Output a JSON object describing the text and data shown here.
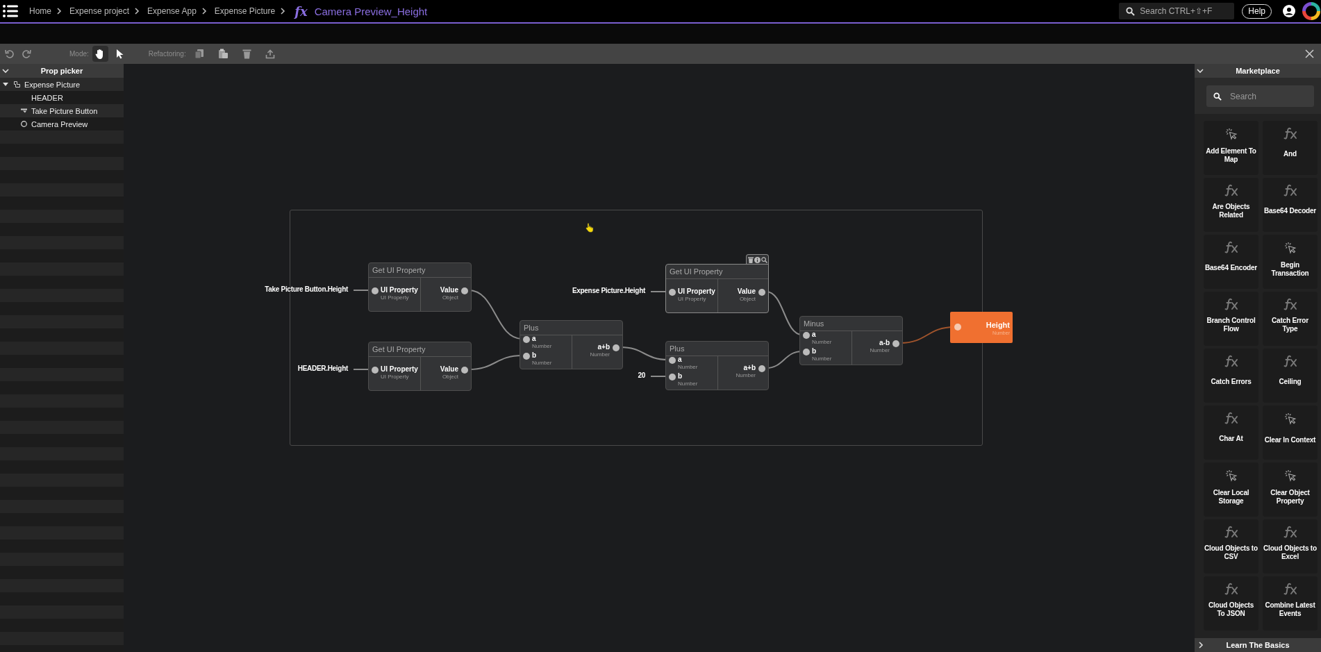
{
  "breadcrumb": [
    "Home",
    "Expense project",
    "Expense App",
    "Expense Picture"
  ],
  "page": {
    "glyph": "fx",
    "title": "Camera Preview_Height"
  },
  "search": {
    "placeholder": "Search CTRL+⇧+F"
  },
  "help_button": "Help",
  "toolbar": {
    "mode_label": "Mode:",
    "modes": [
      {
        "kind": "hand",
        "selected": true
      },
      {
        "kind": "pointer",
        "selected": false
      }
    ],
    "refactoring_label": "Refactoring:"
  },
  "prop_picker": {
    "title": "Prop picker",
    "tree": [
      {
        "label": "Expense Picture",
        "kind": "page",
        "expanded": true,
        "children": [
          {
            "label": "HEADER",
            "kind": "text"
          },
          {
            "label": "Take Picture Button",
            "kind": "button"
          },
          {
            "label": "Camera Preview",
            "kind": "camera"
          }
        ]
      }
    ]
  },
  "graph": {
    "sources": [
      "Take Picture Button.Height",
      "HEADER.Height",
      "Expense Picture.Height",
      "20"
    ],
    "nodes": [
      {
        "title": "Get UI Property",
        "hovered": false,
        "inputs": [
          {
            "name": "UI Property",
            "type": "UI Property"
          }
        ],
        "outputs": [
          {
            "name": "Value",
            "type": "Object"
          }
        ]
      },
      {
        "title": "Get UI Property",
        "hovered": false,
        "inputs": [
          {
            "name": "UI Property",
            "type": "UI Property"
          }
        ],
        "outputs": [
          {
            "name": "Value",
            "type": "Object"
          }
        ]
      },
      {
        "title": "Plus",
        "hovered": false,
        "inputs": [
          {
            "name": "a",
            "type": "Number"
          },
          {
            "name": "b",
            "type": "Number"
          }
        ],
        "outputs": [
          {
            "name": "a+b",
            "type": "Number"
          }
        ]
      },
      {
        "title": "Get UI Property",
        "hovered": true,
        "inputs": [
          {
            "name": "UI Property",
            "type": "UI Property"
          }
        ],
        "outputs": [
          {
            "name": "Value",
            "type": "Object"
          }
        ]
      },
      {
        "title": "Plus",
        "hovered": false,
        "inputs": [
          {
            "name": "a",
            "type": "Number"
          },
          {
            "name": "b",
            "type": "Number"
          }
        ],
        "outputs": [
          {
            "name": "a+b",
            "type": "Number"
          }
        ]
      },
      {
        "title": "Minus",
        "hovered": false,
        "inputs": [
          {
            "name": "a",
            "type": "Number"
          },
          {
            "name": "b",
            "type": "Number"
          }
        ],
        "outputs": [
          {
            "name": "a-b",
            "type": "Number"
          }
        ]
      }
    ],
    "result": {
      "name": "Height",
      "type": "Number"
    }
  },
  "marketplace": {
    "title": "Marketplace",
    "search": {
      "placeholder": "Search"
    },
    "items": [
      {
        "label": "Add Element To Map",
        "kind": "action"
      },
      {
        "label": "And",
        "kind": "function"
      },
      {
        "label": "Are Objects Related",
        "kind": "function"
      },
      {
        "label": "Base64 Decoder",
        "kind": "function"
      },
      {
        "label": "Base64 Encoder",
        "kind": "function"
      },
      {
        "label": "Begin Transaction",
        "kind": "action"
      },
      {
        "label": "Branch Control Flow",
        "kind": "function"
      },
      {
        "label": "Catch Error Type",
        "kind": "function"
      },
      {
        "label": "Catch Errors",
        "kind": "function"
      },
      {
        "label": "Ceiling",
        "kind": "function"
      },
      {
        "label": "Char At",
        "kind": "function"
      },
      {
        "label": "Clear In Context",
        "kind": "action"
      },
      {
        "label": "Clear Local Storage",
        "kind": "action"
      },
      {
        "label": "Clear Object Property",
        "kind": "action"
      },
      {
        "label": "Cloud Objects to CSV",
        "kind": "function"
      },
      {
        "label": "Cloud Objects to Excel",
        "kind": "function"
      },
      {
        "label": "Cloud Objects To JSON",
        "kind": "function"
      },
      {
        "label": "Combine Latest Events",
        "kind": "function"
      }
    ]
  },
  "learn_panel": {
    "title": "Learn The Basics"
  }
}
